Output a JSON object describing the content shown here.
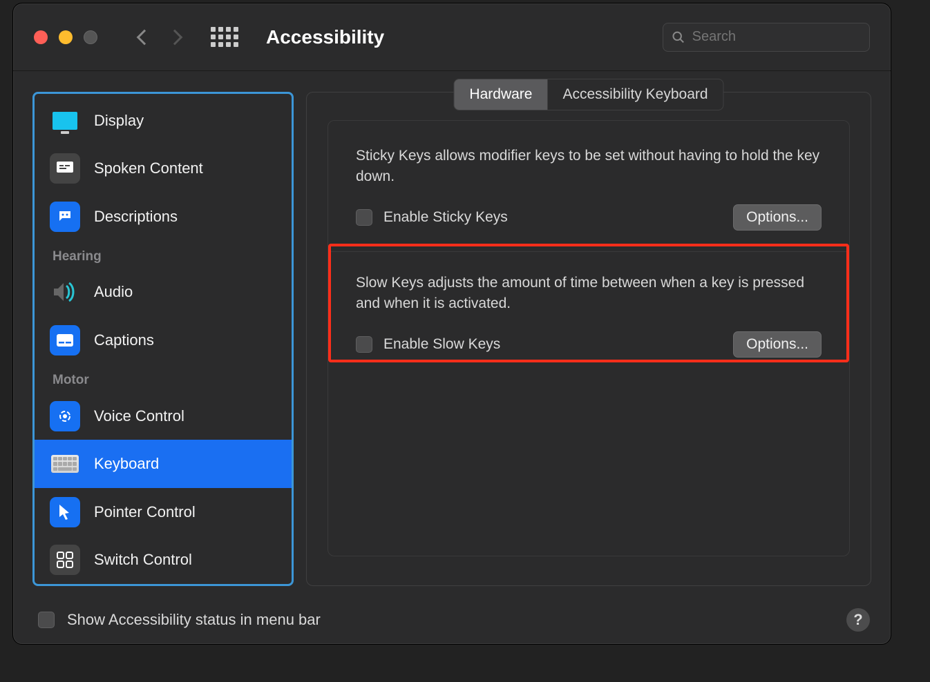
{
  "header": {
    "title": "Accessibility",
    "search_placeholder": "Search"
  },
  "sidebar": {
    "sections": {
      "hearing_label": "Hearing",
      "motor_label": "Motor"
    },
    "items": {
      "display": "Display",
      "spoken": "Spoken Content",
      "descriptions": "Descriptions",
      "audio": "Audio",
      "captions": "Captions",
      "voice_control": "Voice Control",
      "keyboard": "Keyboard",
      "pointer": "Pointer Control",
      "switch": "Switch Control"
    }
  },
  "tabs": {
    "hardware": "Hardware",
    "acc_keyboard": "Accessibility Keyboard"
  },
  "panel": {
    "sticky_desc": "Sticky Keys allows modifier keys to be set without having to hold the key down.",
    "sticky_check": "Enable Sticky Keys",
    "sticky_options": "Options...",
    "slow_desc": "Slow Keys adjusts the amount of time between when a key is pressed and when it is activated.",
    "slow_check": "Enable Slow Keys",
    "slow_options": "Options..."
  },
  "footer": {
    "status_label": "Show Accessibility status in menu bar",
    "help": "?"
  }
}
